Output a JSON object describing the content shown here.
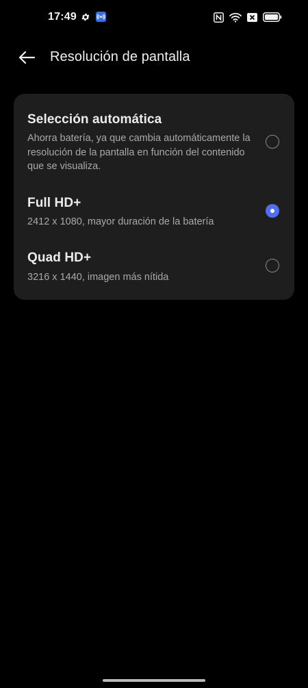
{
  "status_bar": {
    "time": "17:49",
    "icons": [
      "gear-icon",
      "app-notification-icon",
      "nfc-icon",
      "wifi-icon",
      "sim-disabled-icon",
      "battery-icon"
    ]
  },
  "header": {
    "title": "Resolución de pantalla",
    "back_icon": "arrow-left-icon"
  },
  "options": [
    {
      "title": "Selección automática",
      "description": "Ahorra batería, ya que cambia automáticamente la resolución de la pantalla en función del contenido que se visualiza.",
      "selected": false
    },
    {
      "title": "Full HD+",
      "description": "2412 x 1080, mayor duración de la batería",
      "selected": true
    },
    {
      "title": "Quad HD+",
      "description": "3216 x 1440, imagen más nítida",
      "selected": false
    }
  ],
  "colors": {
    "background": "#000000",
    "card": "#1e1e1f",
    "accent": "#4f6ef2",
    "text_primary": "#ececec",
    "text_secondary": "#a9a9a9"
  }
}
